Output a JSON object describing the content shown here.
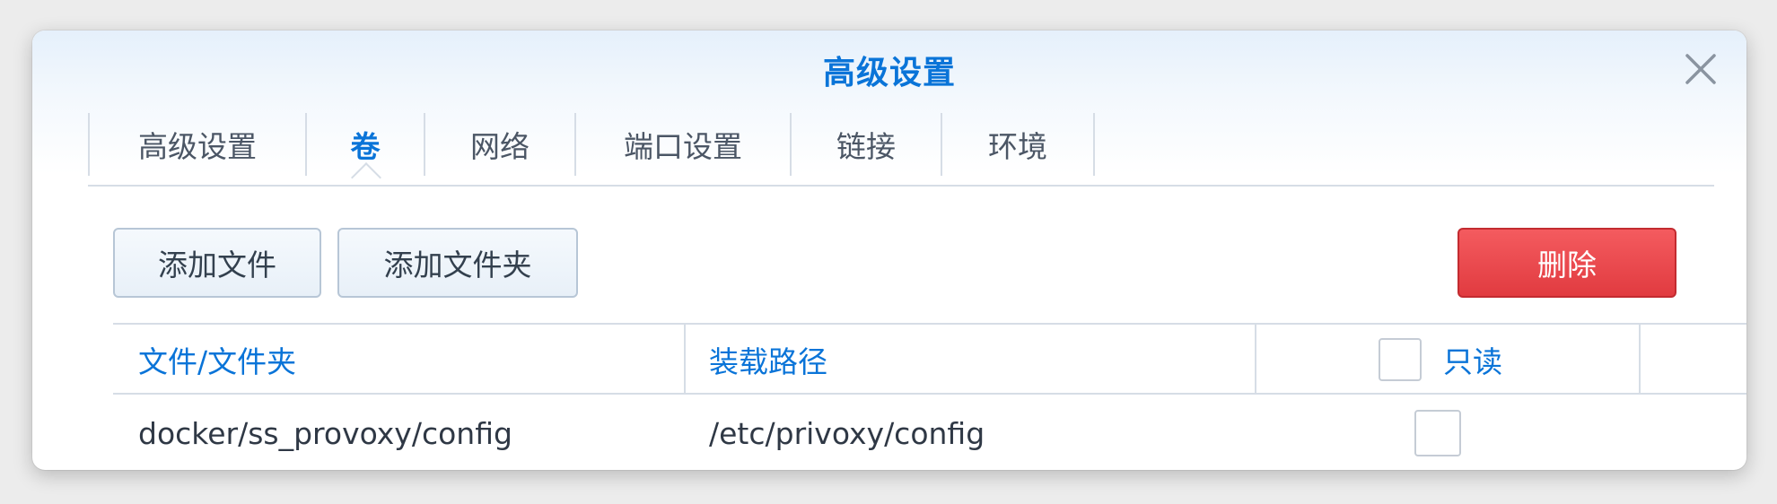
{
  "dialog": {
    "title": "高级设置",
    "close_icon": "close-icon"
  },
  "tabs": [
    {
      "label": "高级设置",
      "active": false
    },
    {
      "label": "卷",
      "active": true
    },
    {
      "label": "网络",
      "active": false
    },
    {
      "label": "端口设置",
      "active": false
    },
    {
      "label": "链接",
      "active": false
    },
    {
      "label": "环境",
      "active": false
    }
  ],
  "toolbar": {
    "add_file_label": "添加文件",
    "add_folder_label": "添加文件夹",
    "delete_label": "删除"
  },
  "table": {
    "columns": {
      "file_folder": "文件/文件夹",
      "mount_path": "装载路径",
      "readonly": "只读"
    },
    "rows": [
      {
        "file_folder": "docker/ss_provoxy/config",
        "mount_path": "/etc/privoxy/config",
        "readonly": false
      }
    ]
  },
  "colors": {
    "accent": "#0a74d8",
    "danger": "#e13b40",
    "border": "#d6dde6"
  }
}
